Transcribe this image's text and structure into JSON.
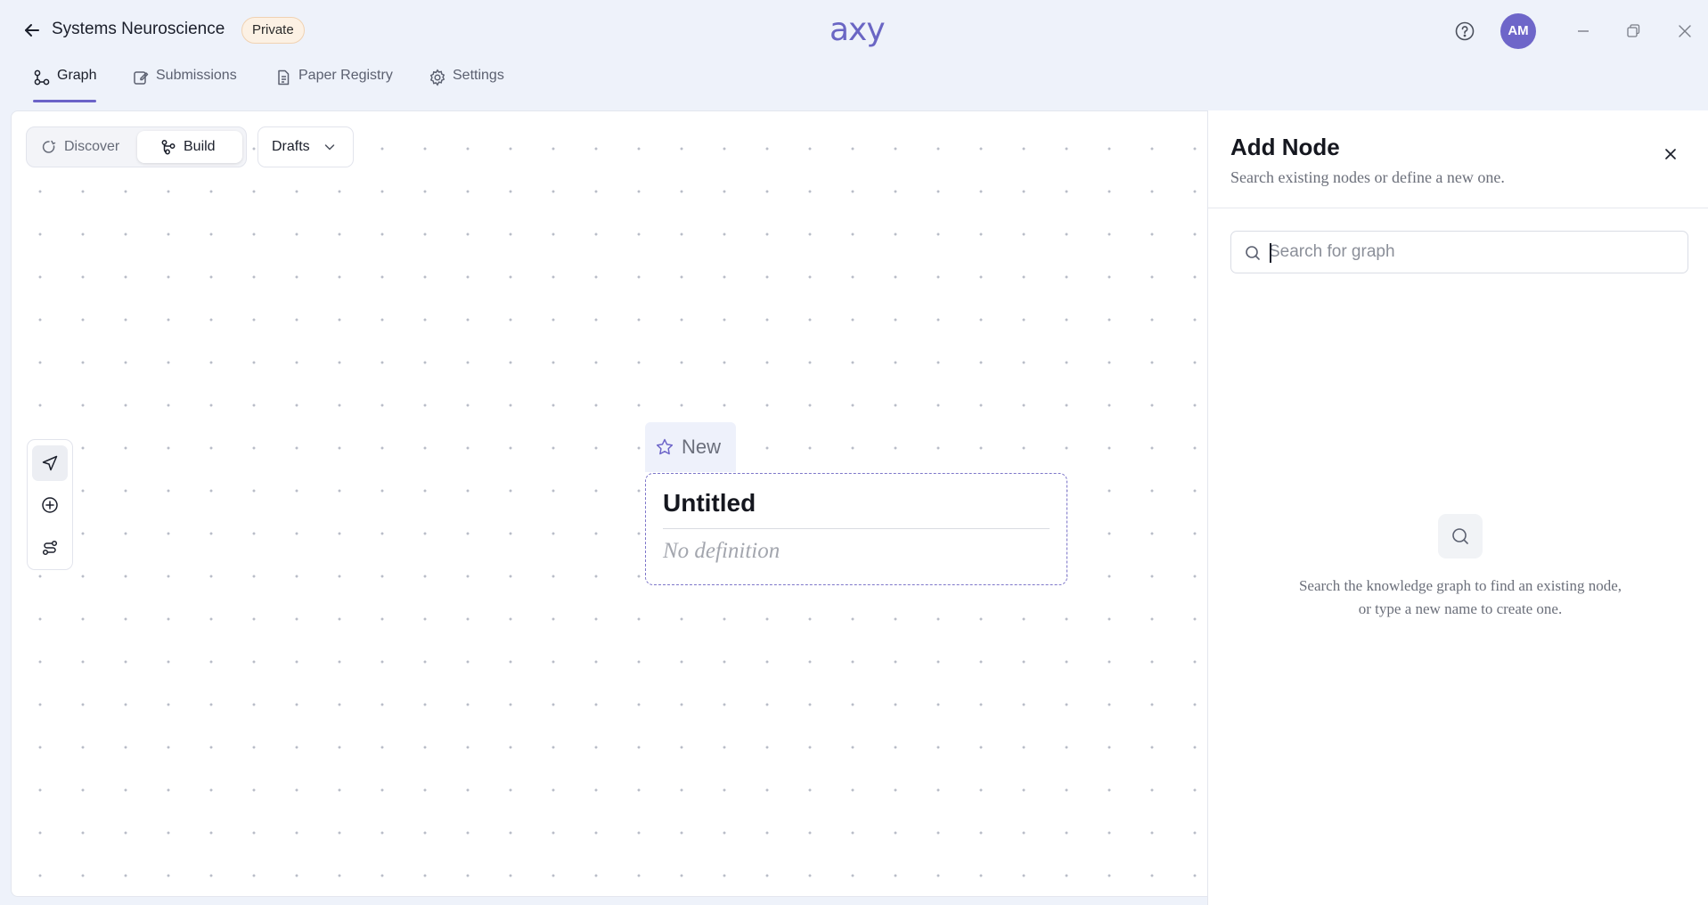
{
  "header": {
    "project_title": "Systems Neuroscience",
    "privacy_badge": "Private",
    "logo_text": "axy",
    "avatar_initials": "AM",
    "icons": [
      "back-arrow-icon",
      "help-icon",
      "minimize-icon",
      "restore-icon",
      "close-icon"
    ]
  },
  "nav": {
    "tabs": [
      {
        "label": "Graph",
        "icon": "graph-icon",
        "active": true
      },
      {
        "label": "Submissions",
        "icon": "submissions-icon",
        "active": false
      },
      {
        "label": "Paper Registry",
        "icon": "document-icon",
        "active": false
      },
      {
        "label": "Settings",
        "icon": "gear-icon",
        "active": false
      }
    ]
  },
  "canvas": {
    "mode_switch": {
      "discover_label": "Discover",
      "build_label": "Build",
      "selected": "Build"
    },
    "drafts_label": "Drafts",
    "tools": [
      "select-pointer-icon",
      "add-node-icon",
      "connect-icon"
    ],
    "new_node": {
      "tag_label": "New",
      "title": "Untitled",
      "definition": "No definition"
    }
  },
  "panel": {
    "title": "Add Node",
    "subtitle": "Search existing nodes or define a new one.",
    "search_placeholder": "Search for graph",
    "search_value": "",
    "empty_state_text": "Search the knowledge graph to find an existing node, or type a new name to create one."
  },
  "colors": {
    "accent": "#6b63c8",
    "avatar_bg": "#6e66c9",
    "badge_bg": "#fcf1e4",
    "app_bg": "#eef2fa"
  }
}
